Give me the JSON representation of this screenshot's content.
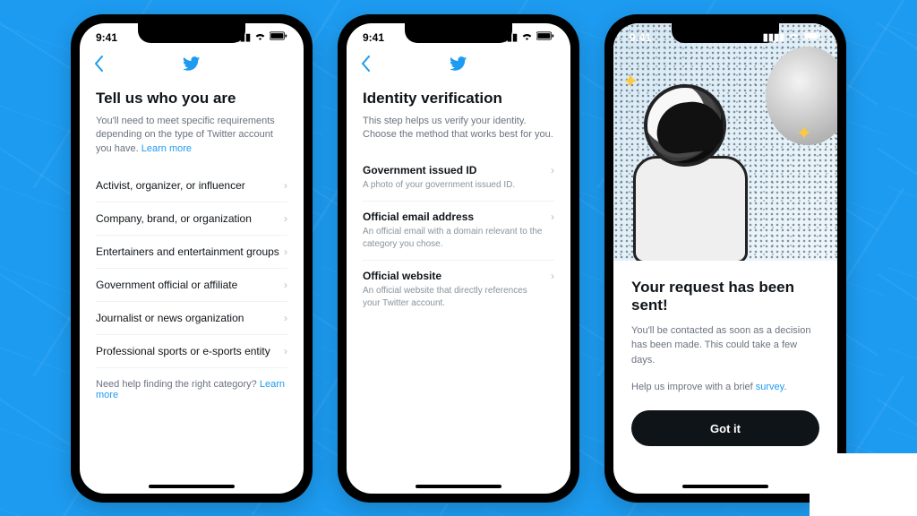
{
  "status": {
    "time": "9:41"
  },
  "phone1": {
    "title": "Tell us who you are",
    "subtitle": "You'll need to meet specific requirements depending on the type of Twitter account you have. ",
    "learn_more": "Learn more",
    "categories": [
      "Activist, organizer, or influencer",
      "Company, brand, or organization",
      "Entertainers and entertainment groups",
      "Government official or affiliate",
      "Journalist or news organization",
      "Professional sports or e-sports entity"
    ],
    "help_text": "Need help finding the right category? ",
    "help_link": "Learn more"
  },
  "phone2": {
    "title": "Identity verification",
    "subtitle": "This step helps us verify your identity. Choose the method that works best for you.",
    "methods": [
      {
        "label": "Government issued ID",
        "desc": "A photo of your government issued ID."
      },
      {
        "label": "Official email address",
        "desc": "An official email with a domain relevant to the category you chose."
      },
      {
        "label": "Official website",
        "desc": "An official website that directly references your Twitter account."
      }
    ]
  },
  "phone3": {
    "title": "Your request has been sent!",
    "desc": "You'll be contacted as soon as a decision has been made. This could take a few days.",
    "survey_prefix": "Help us improve with a brief ",
    "survey_link": "survey",
    "cta": "Got it"
  }
}
